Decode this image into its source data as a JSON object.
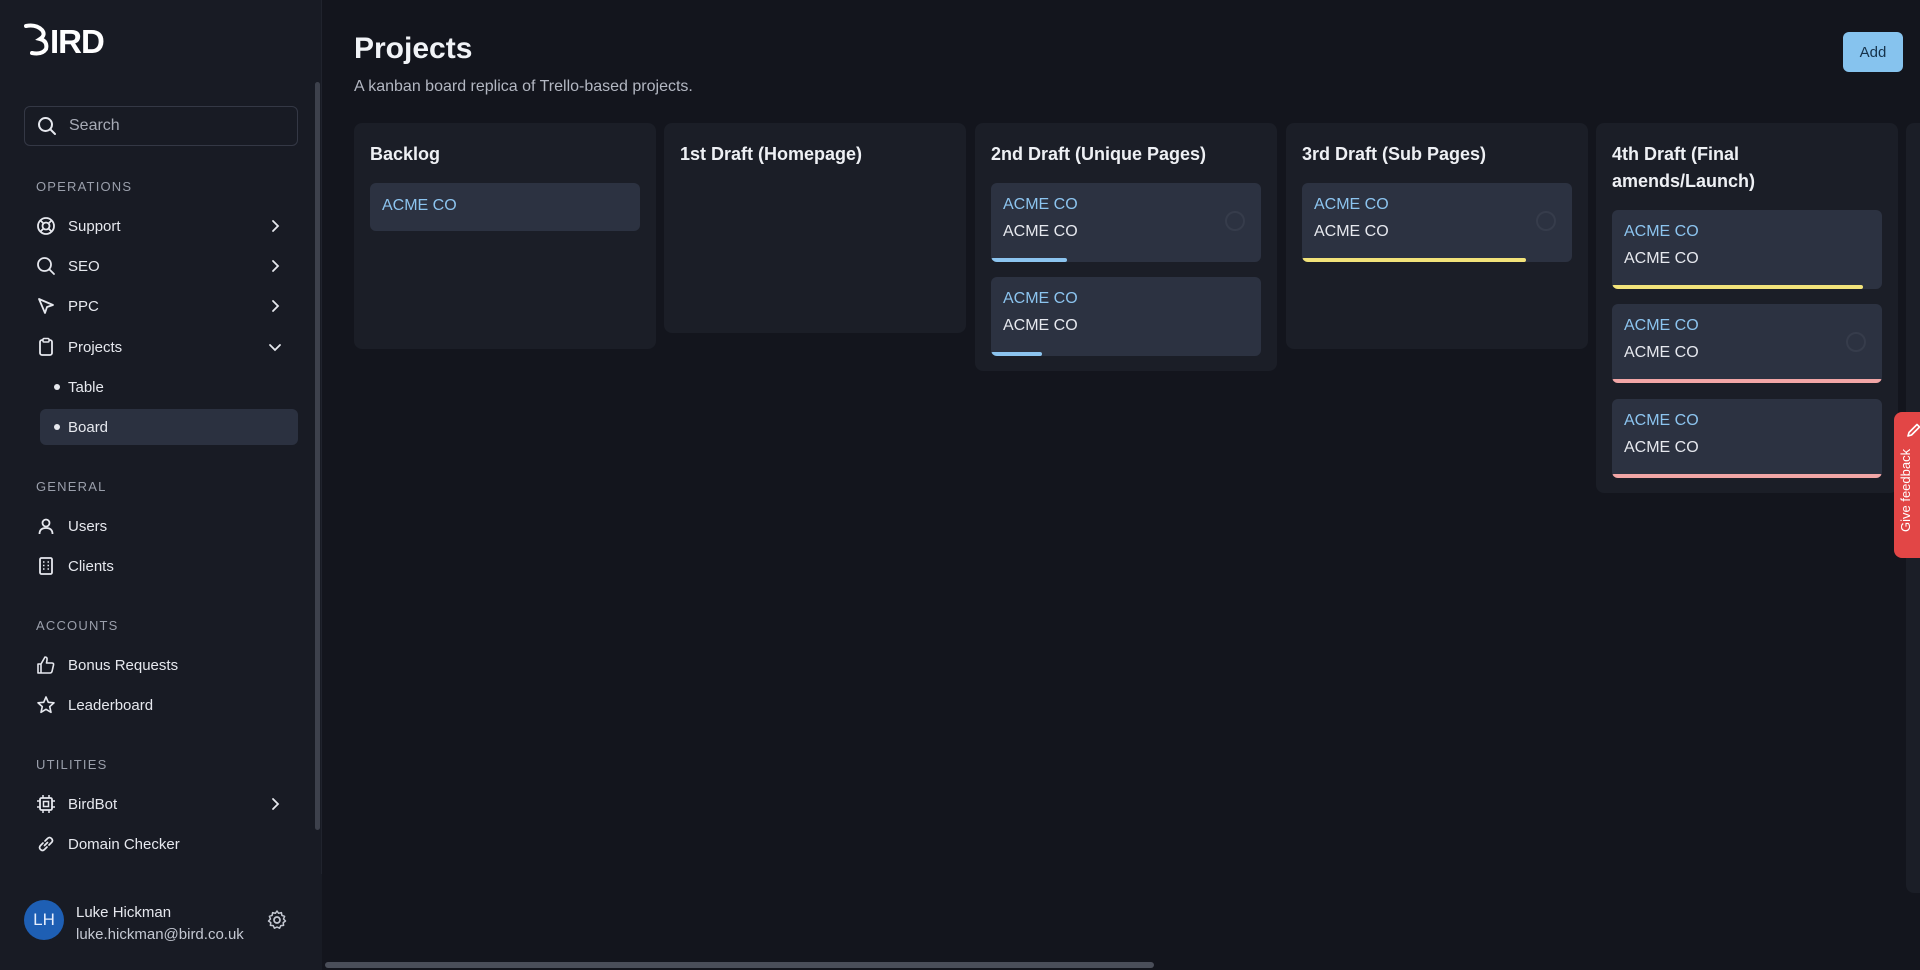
{
  "app": {
    "logo_text": "BIRD"
  },
  "search": {
    "placeholder": "Search"
  },
  "sidebar": {
    "sections": [
      {
        "title": "OPERATIONS"
      },
      {
        "title": "GENERAL"
      },
      {
        "title": "ACCOUNTS"
      },
      {
        "title": "UTILITIES"
      }
    ],
    "items": {
      "support": "Support",
      "seo": "SEO",
      "ppc": "PPC",
      "projects": "Projects",
      "table": "Table",
      "board": "Board",
      "users": "Users",
      "clients": "Clients",
      "bonus_requests": "Bonus Requests",
      "leaderboard": "Leaderboard",
      "birdbot": "BirdBot",
      "domain_checker": "Domain Checker"
    }
  },
  "user": {
    "initials": "LH",
    "name": "Luke Hickman",
    "email": "luke.hickman@bird.co.uk"
  },
  "header": {
    "title": "Projects",
    "subtitle": "A kanban board replica of Trello-based projects.",
    "add_label": "Add"
  },
  "board": {
    "columns": [
      {
        "title": "Backlog",
        "cards": [
          {
            "title": "ACME CO"
          }
        ]
      },
      {
        "title": "1st Draft (Homepage)",
        "cards": []
      },
      {
        "title": "2nd Draft (Unique Pages)",
        "cards": [
          {
            "title": "ACME CO",
            "subtitle": "ACME CO",
            "progress": 0.28,
            "bar_color": "#8cc4ef"
          },
          {
            "title": "ACME CO",
            "subtitle": "ACME CO",
            "progress": 0.19,
            "bar_color": "#8cc4ef"
          }
        ]
      },
      {
        "title": "3rd Draft (Sub Pages)",
        "cards": [
          {
            "title": "ACME CO",
            "subtitle": "ACME CO",
            "progress": 0.83,
            "bar_color": "#f2e37a"
          }
        ]
      },
      {
        "title": "4th Draft (Final amends/Launch)",
        "cards": [
          {
            "title": "ACME CO",
            "subtitle": "ACME CO",
            "progress": 0.93,
            "bar_color": "#f2e37a"
          },
          {
            "title": "ACME CO",
            "subtitle": "ACME CO",
            "progress": 1.0,
            "bar_color": "#f2a6a6"
          },
          {
            "title": "ACME CO",
            "subtitle": "ACME CO",
            "progress": 1.0,
            "bar_color": "#f2a6a6"
          }
        ]
      }
    ]
  },
  "feedback": {
    "label": "Give feedback"
  },
  "colors": {
    "accent": "#86c3ee",
    "background": "#13151d",
    "sidebar": "#181b24",
    "feedback": "#e24646"
  }
}
